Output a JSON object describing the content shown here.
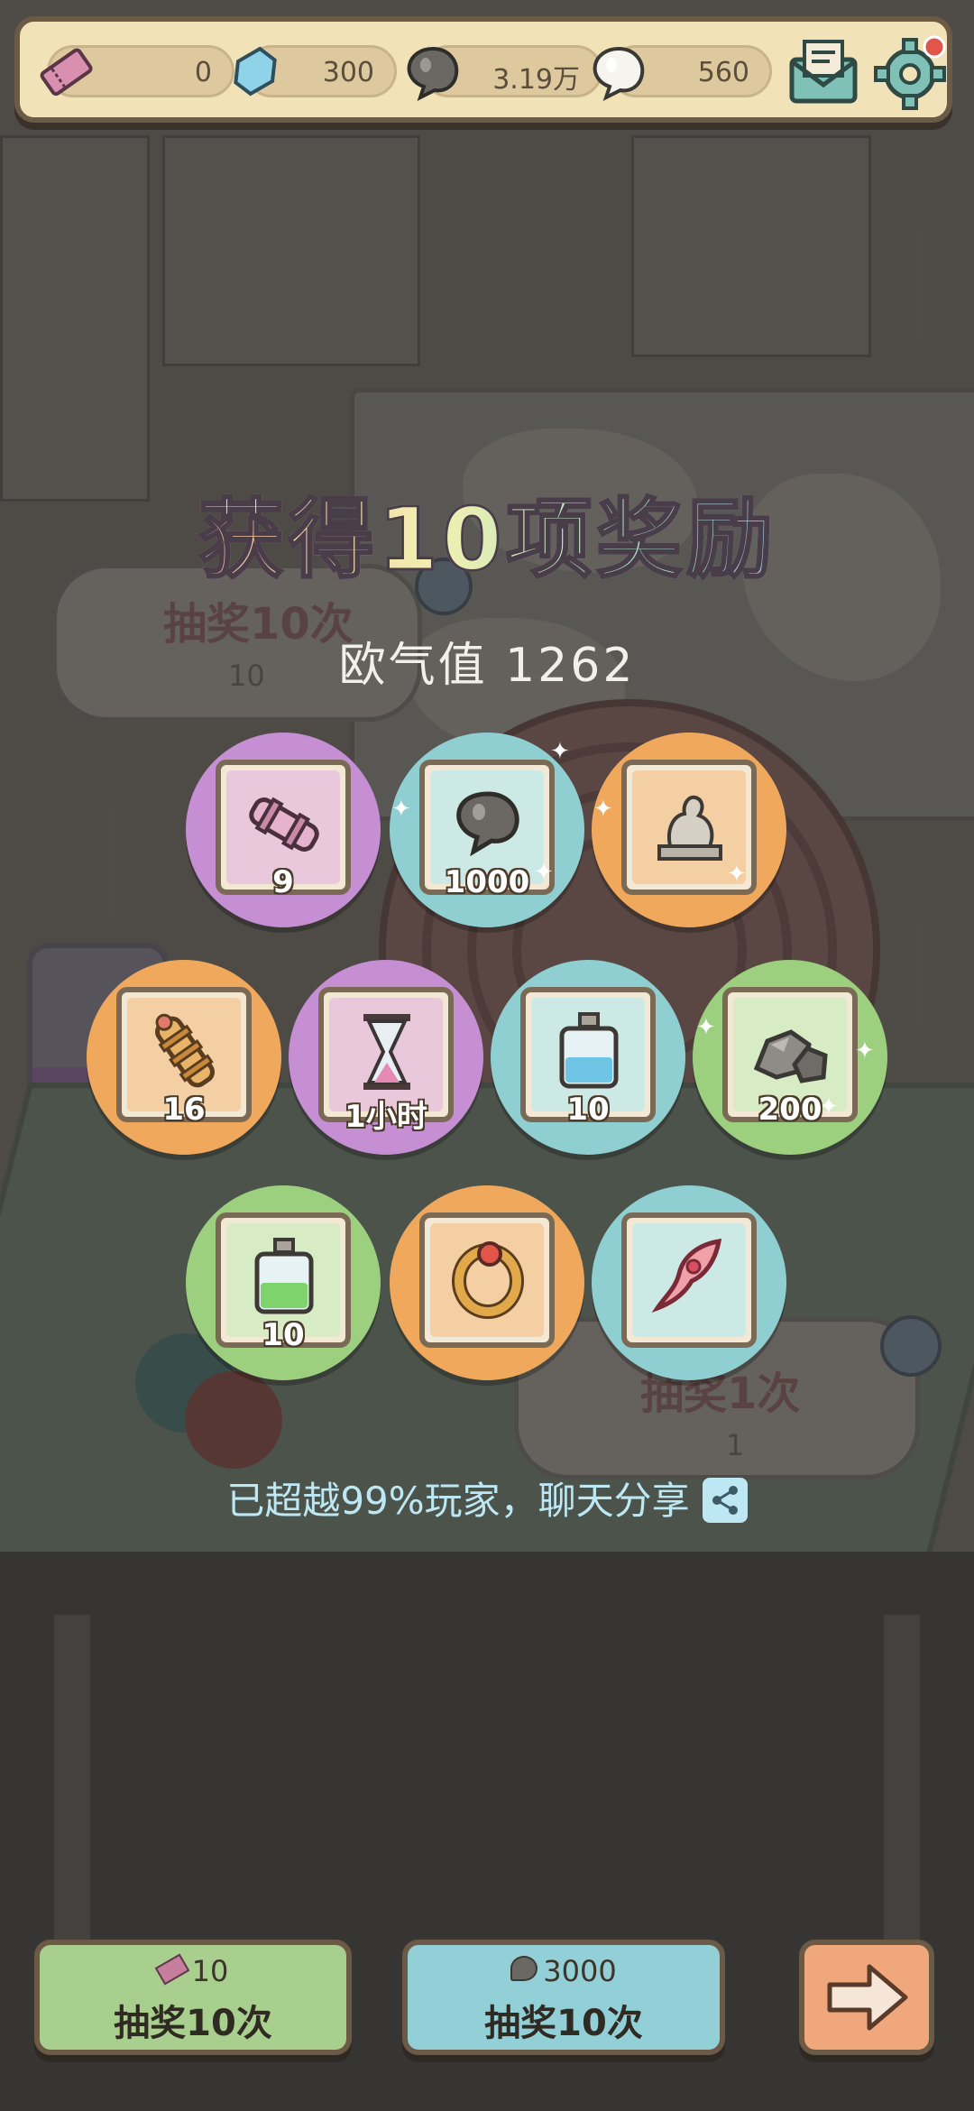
{
  "topbar": {
    "tickets": "0",
    "crystals": "300",
    "gray_souls": "3.19万",
    "white_souls": "560",
    "icons": [
      "ticket-icon",
      "crystal-icon",
      "gray-soul-icon",
      "white-soul-icon",
      "mail-icon",
      "settings-gear-icon"
    ],
    "notification_dot_color": "#e2564a"
  },
  "title": "获得10项奖励",
  "luck_label": "欧气值 1262",
  "background_panels": {
    "left_label": "抽奖10次",
    "left_cost": "10",
    "right_label": "抽奖1次",
    "right_cost": "1"
  },
  "rewards": [
    {
      "name": "telescope-scroll",
      "qty": "9",
      "ring": "#c68fd4",
      "card": "#e9c8dc"
    },
    {
      "name": "gray-soul",
      "qty": "1000",
      "ring": "#8fcfd1",
      "card": "#cde9e6"
    },
    {
      "name": "statue",
      "qty": "",
      "ring": "#f0a95c",
      "card": "#f4cfa4"
    },
    {
      "name": "gold-scroll",
      "qty": "16",
      "ring": "#f0a95c",
      "card": "#f4cfa4"
    },
    {
      "name": "hourglass",
      "qty": "1小时",
      "ring": "#c68fd4",
      "card": "#e9c8dc"
    },
    {
      "name": "blue-potion",
      "qty": "10",
      "ring": "#8fcfd1",
      "card": "#cde9e6"
    },
    {
      "name": "stone-ore",
      "qty": "200",
      "ring": "#9ccf7e",
      "card": "#d7ebc5"
    },
    {
      "name": "green-potion",
      "qty": "10",
      "ring": "#9ccf7e",
      "card": "#d7ebc5"
    },
    {
      "name": "ruby-ring",
      "qty": "",
      "ring": "#f0a95c",
      "card": "#f4cfa4"
    },
    {
      "name": "red-feather",
      "qty": "",
      "ring": "#8fcfd1",
      "card": "#cde9e6"
    }
  ],
  "share_text": "已超越99%玩家，聊天分享",
  "buttons": {
    "draw_ten_ticket": {
      "cost": "10",
      "label": "抽奖10次",
      "color": "#a9cf8f"
    },
    "draw_ten_soul": {
      "cost": "3000",
      "label": "抽奖10次",
      "color": "#92cfd6"
    },
    "next": {
      "color": "#f0a77b"
    }
  }
}
